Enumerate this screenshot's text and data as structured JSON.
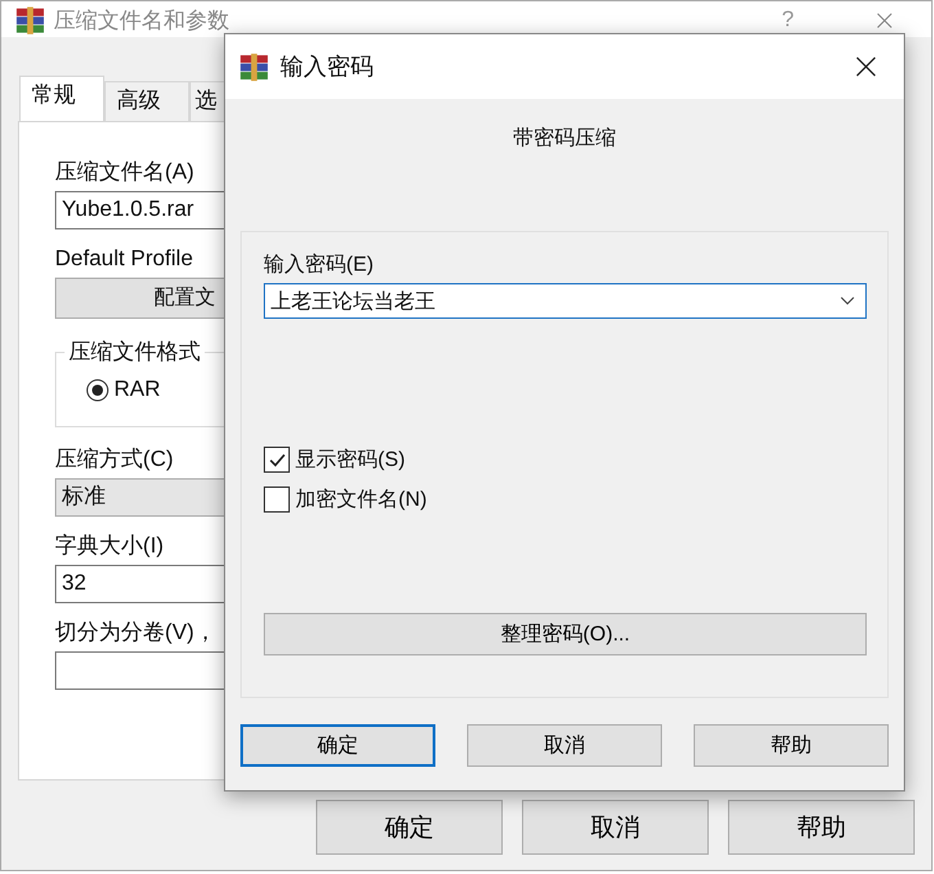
{
  "main_window": {
    "title": "压缩文件名和参数",
    "help": "?",
    "tabs": [
      {
        "label": "常规",
        "selected": true
      },
      {
        "label": "高级",
        "selected": false
      },
      {
        "label": "选",
        "selected": false
      }
    ],
    "fields": [
      {
        "kind": "text",
        "label": "压缩文件名(A)",
        "value": "Yube1.0.5.rar"
      },
      {
        "kind": "button",
        "label": "Default Profile",
        "value": "配置文"
      },
      {
        "kind": "group",
        "label": "压缩文件格式",
        "options": [
          {
            "label": "RAR",
            "selected": true
          }
        ]
      },
      {
        "kind": "select",
        "label": "压缩方式(C)",
        "value": "标准"
      },
      {
        "kind": "text",
        "label": "字典大小(I)",
        "value": "32"
      },
      {
        "kind": "text",
        "label": "切分为分卷(V)，"
      }
    ],
    "buttons": [
      "确定",
      "取消",
      "帮助"
    ]
  },
  "dialog": {
    "title": "输入密码",
    "heading": "带密码压缩",
    "password_label": "输入密码(E)",
    "password": "上老王论坛当老王",
    "options": [
      {
        "label": "显示密码(S)",
        "checked": true
      },
      {
        "label": "加密文件名(N)",
        "checked": false
      }
    ],
    "manage_button": "整理密码(O)...",
    "buttons": [
      {
        "label": "确定",
        "default": true
      },
      {
        "label": "取消",
        "default": false
      },
      {
        "label": "帮助",
        "default": false
      }
    ]
  }
}
